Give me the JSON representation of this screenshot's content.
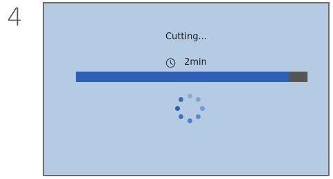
{
  "step": {
    "number": "4"
  },
  "dialog": {
    "status_text": "Cutting...",
    "timer": {
      "icon": "clock-icon",
      "value": "2min"
    },
    "progress": {
      "fraction": 0.92
    },
    "spinner": {
      "icon": "loading-spinner-icon"
    }
  },
  "colors": {
    "screen_background": "#b4cbe3",
    "progress_fill": "#2f5fb3",
    "progress_track": "#555555",
    "border": "#6c6c6c"
  }
}
